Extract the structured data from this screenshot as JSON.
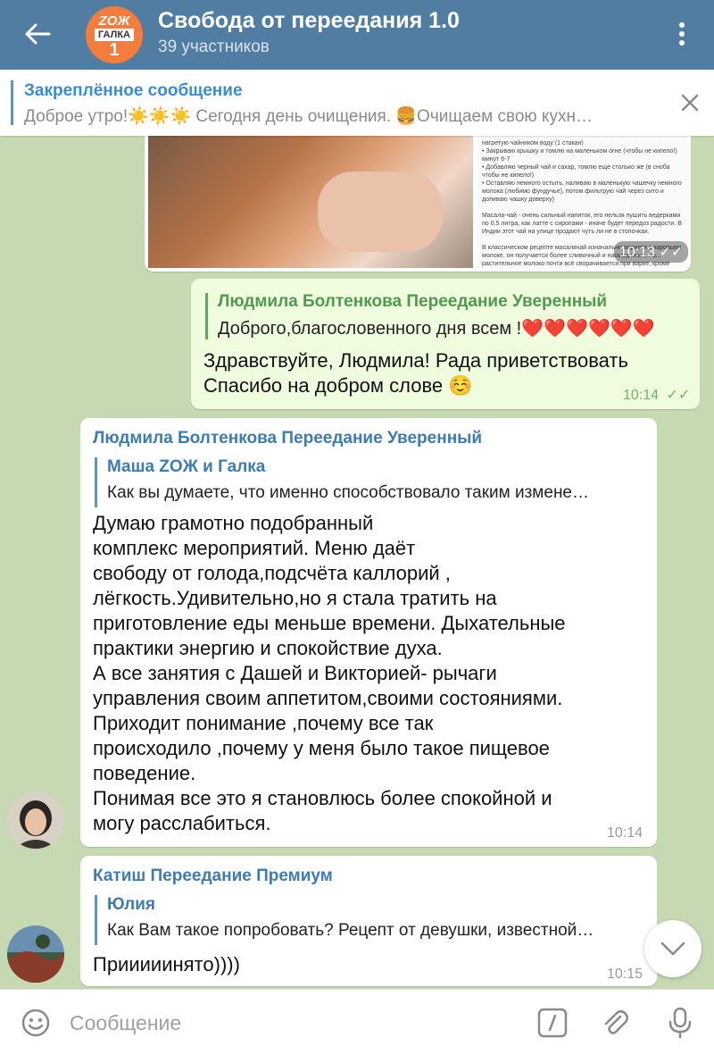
{
  "header": {
    "title": "Свобода от переедания 1.0",
    "subtitle": "39 участников",
    "avatar": {
      "line1": "ZOЖ",
      "line2": "ГАЛКА",
      "line3": "1"
    }
  },
  "pinned": {
    "title": "Закреплённое сообщение",
    "text": "Доброе утро!☀️☀️☀️   Сегодня день очищения.  🍔Очищаем свою кухн…"
  },
  "messages": {
    "image_msg": {
      "time": "10:13",
      "doc_text": "нагретую чайником воду (1 стакан)\n• Закрываю крышку и томлю на маленьком огне (чтобы не кипело!) минут 6-7\n• Добавляю черный чай и сахар, томлю еще столько же (в сноба чтобы не кипело!)\n• Оставляю немного остыть, наливаю в маленькую чашечку немного молока (любимо фундучье), потом фильтрую чай через сито и доливаю чашку доверху)\n\nМасала-чай - очень сильный напиток, его нельзя пушить ведерками по 0,5 литра, как латте с сиропами - иначе будет передоз радости. В Индии этот чай на улице продают чуть ли не в стопочках.\n\nВ классическом рецепте масалачай изначально варится в коровьем молоке, он получается более сливочный и насыщенный, но... растительное молоко почти всё сворачивается при варке, кроме соевого (на нём как раз можно варить веганский вариант)"
    },
    "out_msg": {
      "reply_name": "Людмила Болтенкова Переедание Уверенный",
      "reply_text": "Доброго,благословенного дня всем !❤️❤️❤️❤️❤️❤️",
      "text": "Здравствуйте, Людмила! Рада приветствовать\nСпасибо на добром слове ☺️",
      "time": "10:14"
    },
    "in_msg1": {
      "sender": "Людмила Болтенкова Переедание Уверенный",
      "reply_name": "Маша ZOЖ и Галка",
      "reply_text": "Как вы думаете, что именно способствовало таким измене…",
      "text": "Думаю грамотно подобранный\nкомплекс мероприятий. Меню даёт\nсвободу от голода,подсчёта каллорий ,\nлёгкость.Удивительно,но я стала тратить на\nприготовление еды меньше времени. Дыхательные\nпрактики энергию и спокойствие духа.\nА все занятия с Дашей и Викторией- рычаги\nуправления своим аппетитом,своими состояниями.\nПриходит понимание ,почему все так\nпроисходило ,почему у меня было такое пищевое\nповедение.\nПонимая все это я становлюсь более спокойной и\nмогу расслабиться.",
      "time": "10:14"
    },
    "in_msg2": {
      "sender": "Катиш Переедание Премиум",
      "reply_name": "Юлия",
      "reply_text": "Как Вам такое попробовать? Рецепт от девушки, известной…",
      "text": "Прииииинято))))",
      "time": "10:15"
    }
  },
  "input": {
    "placeholder": "Сообщение"
  },
  "colors": {
    "header": "#517da2",
    "chat_bg": "#c6d9b3",
    "out_bubble": "#effdde",
    "accent": "#3d7cb3"
  }
}
